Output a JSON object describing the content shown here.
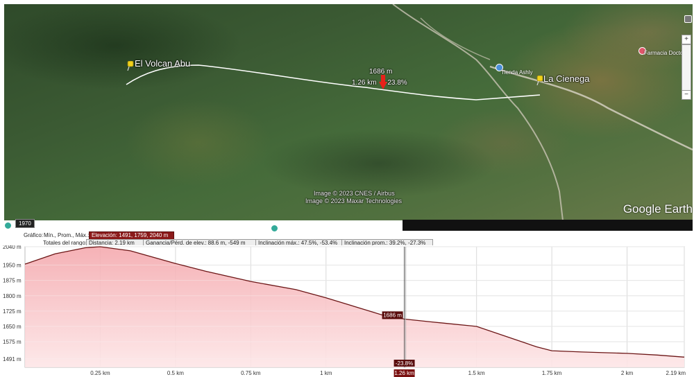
{
  "map": {
    "place_labels": [
      "El Volcan Abu",
      "La Cienega"
    ],
    "poi_labels": [
      "Tienda Ashly",
      "Farmacia Doctor F"
    ],
    "cursor_readout": {
      "elevation": "1686 m",
      "distance": "1.26 km",
      "slope": "-23.8%"
    },
    "credits": [
      "Image © 2023 CNES / Airbus",
      "Image © 2023 Maxar Technologies"
    ],
    "logo": "Google Earth",
    "year": "1970",
    "zoom_in": "+",
    "zoom_out": "−",
    "colors": {
      "path": "#ffffff",
      "pin": "#f2d21a",
      "marker": "#e8211a"
    }
  },
  "stats": {
    "graph_label": "Gráfico:",
    "graph_modes": "Mín., Prom., Máx.:",
    "elevation": "Elevación: 1491, 1759, 2040 m",
    "totals_label": "Totales del rango:",
    "distance": "Distancia: 2.19 km",
    "gain_loss": "Ganancia/Pérd. de elev.: 88.6 m, -549 m",
    "max_slope": "Inclinación máx.: 47.5%, -53.4%",
    "avg_slope": "Inclinación prom.: 39.2%, -27.3%"
  },
  "chart_data": {
    "type": "area",
    "xlabel": "",
    "ylabel": "",
    "xlim": [
      0,
      2.19
    ],
    "ylim": [
      1450,
      2040
    ],
    "y_ticks": [
      1491,
      1575,
      1650,
      1725,
      1800,
      1875,
      1950,
      2040
    ],
    "y_tick_labels": [
      "1491 m",
      "1575 m",
      "1650 m",
      "1725 m",
      "1800 m",
      "1875 m",
      "1950 m",
      "2040 m"
    ],
    "x_ticks": [
      0.25,
      0.5,
      0.75,
      1.0,
      1.26,
      1.5,
      1.75,
      2.0,
      2.19
    ],
    "x_tick_labels": [
      "0.25 km",
      "0.5 km",
      "0.75 km",
      "1 km",
      "1.26 km",
      "1.5 km",
      "1.75 km",
      "2 km",
      "2.19 km"
    ],
    "x": [
      0,
      0.1,
      0.2,
      0.25,
      0.35,
      0.5,
      0.6,
      0.75,
      0.9,
      1.0,
      1.1,
      1.2,
      1.26,
      1.35,
      1.5,
      1.6,
      1.7,
      1.75,
      1.85,
      2.0,
      2.1,
      2.19
    ],
    "y": [
      1955,
      2005,
      2035,
      2040,
      2020,
      1958,
      1920,
      1870,
      1830,
      1790,
      1745,
      1700,
      1686,
      1672,
      1650,
      1600,
      1550,
      1531,
      1525,
      1518,
      1510,
      1500
    ],
    "cursor": {
      "x": 1.26,
      "y": 1686,
      "elevation_label": "1686 m",
      "slope_label": "-23.8%"
    },
    "colors": {
      "line": "#6b1515",
      "fill_top": "#f4a9ae",
      "fill_bottom": "#fde6e7",
      "grid": "#d9d9d9"
    }
  }
}
